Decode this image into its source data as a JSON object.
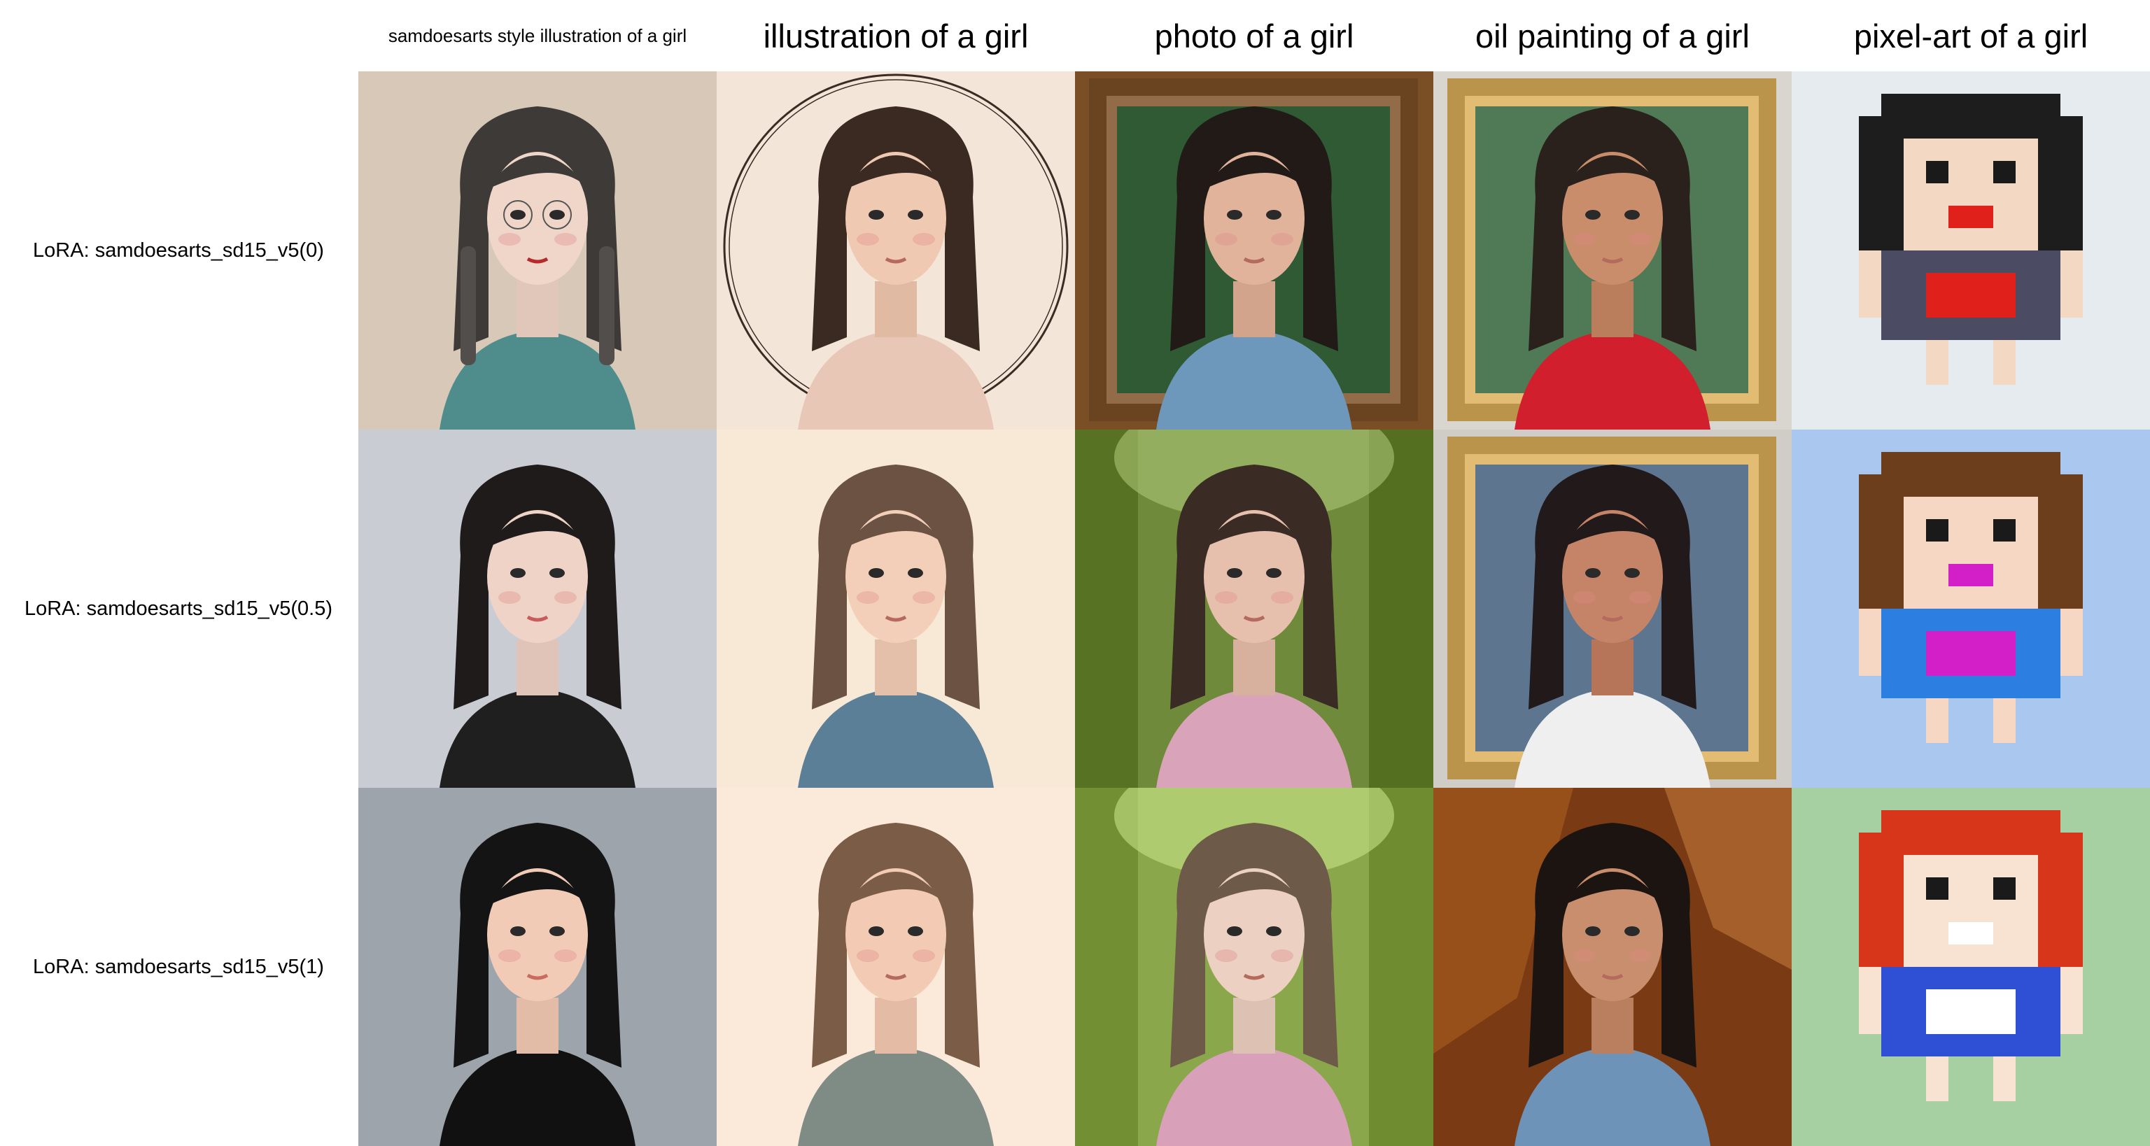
{
  "columns": [
    {
      "label": "samdoesarts style illustration of a girl"
    },
    {
      "label": "illustration of a girl"
    },
    {
      "label": "photo of a girl"
    },
    {
      "label": "oil painting of a girl"
    },
    {
      "label": "pixel-art of a girl"
    }
  ],
  "rows": [
    {
      "label": "LoRA: samdoesarts_sd15_v5(0)"
    },
    {
      "label": "LoRA: samdoesarts_sd15_v5(0.5)"
    },
    {
      "label": "LoRA: samdoesarts_sd15_v5(1)"
    }
  ],
  "cells": [
    [
      {
        "style": "flat-illustration",
        "bg": "#d7c8b8",
        "hair": "#3e3a37",
        "skin": "#efd6c9",
        "clothes": "#4f8c8c",
        "lips": "#b52a2a",
        "braids": true,
        "glasses": true
      },
      {
        "style": "sketch-frame",
        "bg": "#f3e6d8",
        "hair": "#3a2a22",
        "skin": "#f0c9b2",
        "clothes": "#e8c7b6",
        "frame": "oval"
      },
      {
        "style": "photo-frame",
        "bg": "#7a4f26",
        "inner": "#2f5a34",
        "hair": "#221a16",
        "skin": "#e1b39b",
        "clothes": "#6e98bb",
        "frame": "wood"
      },
      {
        "style": "painting-frame",
        "bg": "#d9d6cf",
        "inner": "#4f7a55",
        "hair": "#2b211c",
        "skin": "#c98d6c",
        "clothes": "#d21f2e",
        "frame": "gold"
      },
      {
        "style": "pixel",
        "bg": "#e6ebf0",
        "hair": "#1d1d1d",
        "skin": "#f3d9c4",
        "clothes": "#4b4b63",
        "accent": "#e0211b"
      }
    ],
    [
      {
        "style": "flat-illustration",
        "bg": "#c9ccd3",
        "hair": "#1e1b1a",
        "skin": "#efd3c6",
        "clothes": "#1f1f1f",
        "lips": "#c65c5c"
      },
      {
        "style": "sketch",
        "bg": "#f7e9d6",
        "hair": "#6b5242",
        "skin": "#f3cfb9",
        "clothes": "#5c7f98"
      },
      {
        "style": "photo-forest",
        "bg": "#6f8a3a",
        "hair": "#3a2c24",
        "skin": "#e6c0ad",
        "clothes": "#d9a3b9"
      },
      {
        "style": "painting-frame",
        "bg": "#d0cdc8",
        "inner": "#5e7590",
        "hair": "#22191a",
        "skin": "#c58467",
        "clothes": "#efefef",
        "frame": "gold"
      },
      {
        "style": "pixel",
        "bg": "#a9c7ef",
        "hair": "#6c3e1c",
        "skin": "#f6d7c3",
        "clothes": "#2c7fe0",
        "accent": "#d21fc8"
      }
    ],
    [
      {
        "style": "flat-illustration",
        "bg": "#9ea4ab",
        "hair": "#141414",
        "skin": "#f2cbb7",
        "clothes": "#111111",
        "lips": "#c96b5e"
      },
      {
        "style": "sketch",
        "bg": "#fbeada",
        "hair": "#7b5d47",
        "skin": "#f3cbb4",
        "clothes": "#7f8c85"
      },
      {
        "style": "photo-forest",
        "bg": "#8aa84b",
        "hair": "#6e5a48",
        "skin": "#ecd0c2",
        "clothes": "#d9a0ba"
      },
      {
        "style": "painting",
        "bg": "#7a3a14",
        "inner": "#a45a1d",
        "hair": "#1c1410",
        "skin": "#c98e6d",
        "clothes": "#6e93b8"
      },
      {
        "style": "pixel",
        "bg": "#a6cfa2",
        "hair": "#d7361b",
        "skin": "#f8e2d2",
        "clothes": "#2f4fd4",
        "accent": "#ffffff"
      }
    ]
  ]
}
